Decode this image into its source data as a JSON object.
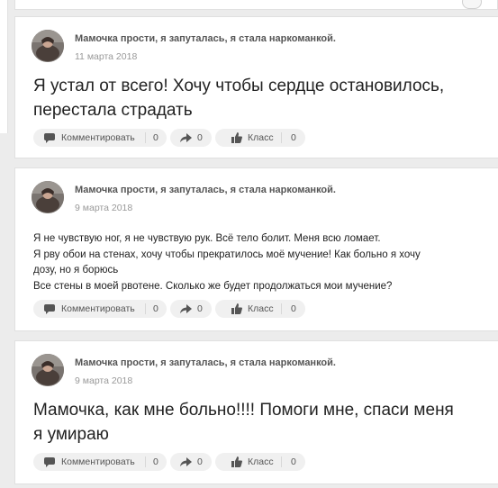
{
  "posts": [
    {
      "author": "Мамочка прости, я запуталась, я стала наркоманкой.",
      "date": "11 марта 2018",
      "lines": [
        "Я устал от всего! Хочу чтобы сердце остановилось,",
        "перестала страдать"
      ],
      "actions": {
        "comment_label": "Комментировать",
        "comment_count": "0",
        "share_count": "0",
        "like_label": "Класс",
        "like_count": "0"
      }
    },
    {
      "author": "Мамочка прости, я запуталась, я стала наркоманкой.",
      "date": "9 марта 2018",
      "lines": [
        "Я не чувствую ног, я не чувствую рук. Всё тело болит. Меня всю ломает.",
        "Я рву обои на стенах, хочу чтобы прекратилось моё мучение! Как больно я хочу",
        "дозу, но я борюсь",
        "Все стены в моей рвотене.  Сколько же будет продолжаться мои мучение?"
      ],
      "actions": {
        "comment_label": "Комментировать",
        "comment_count": "0",
        "share_count": "0",
        "like_label": "Класс",
        "like_count": "0"
      }
    },
    {
      "author": "Мамочка прости, я запуталась, я стала наркоманкой.",
      "date": "9 марта 2018",
      "lines": [
        "Мамочка, как мне больно!!!! Помоги мне, спаси меня",
        "я умираю"
      ],
      "actions": {
        "comment_label": "Комментировать",
        "comment_count": "0",
        "share_count": "0",
        "like_label": "Класс",
        "like_count": "0"
      }
    }
  ],
  "icons": {
    "comment": "comment-icon",
    "share": "share-arrow-icon",
    "like": "thumbs-up-icon"
  },
  "colors": {
    "background": "#ececec",
    "card": "#ffffff",
    "pill": "#f0f0f0",
    "author": "#555555",
    "date": "#999999"
  }
}
